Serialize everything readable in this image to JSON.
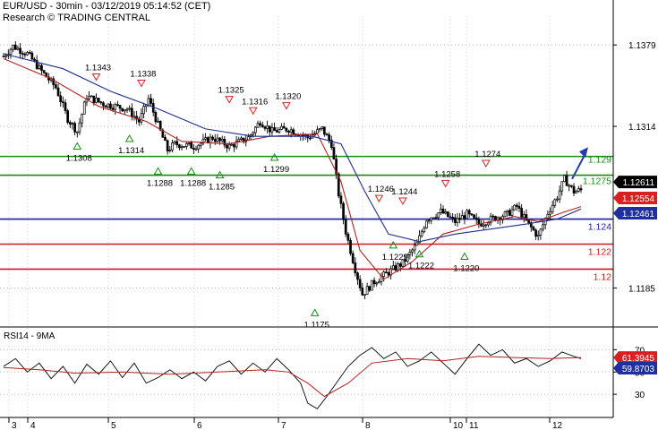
{
  "header": {
    "title": "EUR/USD - 30min - 03/12/2019 05:14:52 (CET)",
    "subtitle": "Research © TRADING CENTRAL"
  },
  "colors": {
    "candle": "#000000",
    "ma_fast": "#b22222",
    "ma_slow": "#1c2f8f",
    "resistance": "#1a8a1a",
    "pivot": "#1a1aa8",
    "support": "#c81e1e",
    "arrow": "#1f3ea8"
  },
  "chart_data": [
    {
      "type": "candlestick",
      "title": "EUR/USD - 30min - 03/12/2019 05:14:52 (CET)",
      "x_labels": [
        "3",
        "4",
        "5",
        "6",
        "7",
        "8",
        "10",
        "11",
        "12"
      ],
      "y_ticks": [
        "1.1379",
        "1.1314",
        "1.1185"
      ],
      "ylim": [
        1.1156,
        1.1402
      ],
      "close_path": [
        [
          0,
          1.137
        ],
        [
          4,
          1.1378
        ],
        [
          10,
          1.1372
        ],
        [
          16,
          1.1358
        ],
        [
          22,
          1.1345
        ],
        [
          27,
          1.132
        ],
        [
          31,
          1.131
        ],
        [
          35,
          1.1338
        ],
        [
          42,
          1.1332
        ],
        [
          52,
          1.1328
        ],
        [
          57,
          1.1318
        ],
        [
          61,
          1.1336
        ],
        [
          66,
          1.131
        ],
        [
          69,
          1.1295
        ],
        [
          72,
          1.13
        ],
        [
          80,
          1.1298
        ],
        [
          88,
          1.1305
        ],
        [
          95,
          1.1298
        ],
        [
          103,
          1.1305
        ],
        [
          108,
          1.1318
        ],
        [
          113,
          1.131
        ],
        [
          120,
          1.1312
        ],
        [
          128,
          1.1305
        ],
        [
          134,
          1.1312
        ],
        [
          138,
          1.13
        ],
        [
          141,
          1.126
        ],
        [
          144,
          1.123
        ],
        [
          148,
          1.12
        ],
        [
          151,
          1.118
        ],
        [
          156,
          1.119
        ],
        [
          160,
          1.1195
        ],
        [
          168,
          1.1205
        ],
        [
          174,
          1.122
        ],
        [
          178,
          1.124
        ],
        [
          184,
          1.1246
        ],
        [
          190,
          1.1238
        ],
        [
          195,
          1.1244
        ],
        [
          200,
          1.1236
        ],
        [
          205,
          1.124
        ],
        [
          212,
          1.1244
        ],
        [
          216,
          1.125
        ],
        [
          220,
          1.1238
        ],
        [
          225,
          1.1226
        ],
        [
          229,
          1.1245
        ],
        [
          233,
          1.1258
        ],
        [
          236,
          1.1272
        ],
        [
          240,
          1.1262
        ],
        [
          243,
          1.1263
        ]
      ],
      "ma_fast": [
        [
          0,
          1.1368
        ],
        [
          20,
          1.1352
        ],
        [
          40,
          1.133
        ],
        [
          60,
          1.1318
        ],
        [
          75,
          1.1302
        ],
        [
          95,
          1.13
        ],
        [
          112,
          1.1306
        ],
        [
          132,
          1.1308
        ],
        [
          142,
          1.127
        ],
        [
          150,
          1.1215
        ],
        [
          160,
          1.1192
        ],
        [
          172,
          1.1206
        ],
        [
          185,
          1.1228
        ],
        [
          200,
          1.1236
        ],
        [
          215,
          1.1242
        ],
        [
          225,
          1.1238
        ],
        [
          235,
          1.1245
        ],
        [
          243,
          1.125
        ]
      ],
      "ma_slow": [
        [
          0,
          1.1372
        ],
        [
          25,
          1.136
        ],
        [
          45,
          1.1342
        ],
        [
          65,
          1.1328
        ],
        [
          85,
          1.1312
        ],
        [
          105,
          1.1306
        ],
        [
          130,
          1.1306
        ],
        [
          142,
          1.13
        ],
        [
          152,
          1.1262
        ],
        [
          162,
          1.1228
        ],
        [
          175,
          1.1222
        ],
        [
          190,
          1.1228
        ],
        [
          205,
          1.1232
        ],
        [
          220,
          1.1236
        ],
        [
          233,
          1.124
        ],
        [
          243,
          1.1248
        ]
      ],
      "levels": [
        {
          "value": 1.129,
          "label": "1.129",
          "color": "#1a8a1a"
        },
        {
          "value": 1.1275,
          "label": "1.1275",
          "color": "#1a8a1a"
        },
        {
          "value": 1.124,
          "label": "1.124",
          "color": "#1a1aa8"
        },
        {
          "value": 1.122,
          "label": "1.122",
          "color": "#c81e1e"
        },
        {
          "value": 1.12,
          "label": "1.12",
          "color": "#c81e1e"
        }
      ],
      "price_tags": [
        {
          "value": 1.1261,
          "label": "1.12611",
          "bg": "#000000",
          "fg": "#ffffff"
        },
        {
          "value": 1.12554,
          "label": "1.12554",
          "bg": "#d92020",
          "fg": "#ffffff"
        },
        {
          "value": 1.12461,
          "label": "1.12461",
          "bg": "#1f2fa0",
          "fg": "#ffffff"
        }
      ],
      "highs": [
        {
          "x": 39,
          "value": 1.1343,
          "label": "1.1343"
        },
        {
          "x": 58,
          "value": 1.1338,
          "label": "1.1338"
        },
        {
          "x": 95,
          "value": 1.1325,
          "label": "1.1325"
        },
        {
          "x": 105,
          "value": 1.1316,
          "label": "1.1316"
        },
        {
          "x": 119,
          "value": 1.132,
          "label": "1.1320"
        },
        {
          "x": 158,
          "value": 1.1246,
          "label": "1.1246"
        },
        {
          "x": 168,
          "value": 1.1244,
          "label": "1.1244"
        },
        {
          "x": 186,
          "value": 1.1258,
          "label": "1.1258"
        },
        {
          "x": 203,
          "value": 1.1274,
          "label": "1.1274"
        }
      ],
      "lows": [
        {
          "x": 31,
          "value": 1.1308,
          "label": "1.1308"
        },
        {
          "x": 53,
          "value": 1.1314,
          "label": "1.1314"
        },
        {
          "x": 65,
          "value": 1.1288,
          "label": "1.1288"
        },
        {
          "x": 79,
          "value": 1.1288,
          "label": "1.1288"
        },
        {
          "x": 91,
          "value": 1.1285,
          "label": "1.1285"
        },
        {
          "x": 114,
          "value": 1.1299,
          "label": "1.1299"
        },
        {
          "x": 131,
          "value": 1.1175,
          "label": "1.1175"
        },
        {
          "x": 164,
          "value": 1.1229,
          "label": "1.1229"
        },
        {
          "x": 175,
          "value": 1.1222,
          "label": "1.1222"
        },
        {
          "x": 194,
          "value": 1.122,
          "label": "1.1220"
        }
      ]
    },
    {
      "type": "line",
      "title": "RSI14 - 9MA",
      "y_ticks": [
        "70",
        "50",
        "30"
      ],
      "ylim": [
        10,
        88
      ],
      "series": [
        {
          "values": [
            [
              0,
              55
            ],
            [
              5,
              62
            ],
            [
              10,
              50
            ],
            [
              15,
              58
            ],
            [
              20,
              44
            ],
            [
              25,
              55
            ],
            [
              30,
              40
            ],
            [
              35,
              57
            ],
            [
              40,
              48
            ],
            [
              45,
              60
            ],
            [
              50,
              45
            ],
            [
              55,
              58
            ],
            [
              60,
              40
            ],
            [
              65,
              45
            ],
            [
              70,
              52
            ],
            [
              75,
              44
            ],
            [
              80,
              50
            ],
            [
              85,
              42
            ],
            [
              90,
              55
            ],
            [
              95,
              60
            ],
            [
              100,
              48
            ],
            [
              105,
              58
            ],
            [
              110,
              50
            ],
            [
              115,
              62
            ],
            [
              120,
              52
            ],
            [
              125,
              40
            ],
            [
              128,
              22
            ],
            [
              132,
              17
            ],
            [
              136,
              28
            ],
            [
              140,
              40
            ],
            [
              145,
              55
            ],
            [
              150,
              65
            ],
            [
              155,
              72
            ],
            [
              160,
              62
            ],
            [
              165,
              68
            ],
            [
              170,
              55
            ],
            [
              175,
              60
            ],
            [
              180,
              68
            ],
            [
              185,
              58
            ],
            [
              190,
              48
            ],
            [
              195,
              62
            ],
            [
              200,
              75
            ],
            [
              205,
              65
            ],
            [
              210,
              70
            ],
            [
              215,
              58
            ],
            [
              220,
              62
            ],
            [
              225,
              55
            ],
            [
              230,
              60
            ],
            [
              235,
              68
            ],
            [
              240,
              64
            ],
            [
              243,
              62
            ]
          ]
        },
        {
          "values": [
            [
              0,
              54
            ],
            [
              15,
              52
            ],
            [
              30,
              49
            ],
            [
              50,
              50
            ],
            [
              70,
              48
            ],
            [
              90,
              50
            ],
            [
              110,
              52
            ],
            [
              120,
              50
            ],
            [
              128,
              40
            ],
            [
              135,
              28
            ],
            [
              145,
              40
            ],
            [
              155,
              58
            ],
            [
              170,
              62
            ],
            [
              185,
              60
            ],
            [
              200,
              64
            ],
            [
              215,
              63
            ],
            [
              230,
              62
            ],
            [
              243,
              63
            ]
          ]
        }
      ],
      "price_tags": [
        {
          "value": 61.3945,
          "label": "61.3945",
          "bg": "#d92020",
          "fg": "#ffffff"
        },
        {
          "value": 59.8703,
          "label": "59.8703",
          "bg": "#1f2fa0",
          "fg": "#ffffff"
        }
      ]
    }
  ]
}
